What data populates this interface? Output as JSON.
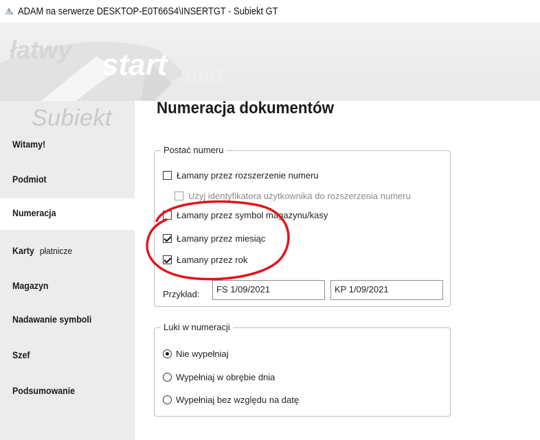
{
  "window": {
    "title": "ADAM na serwerze DESKTOP-E0T66S4\\INSERTGT - Subiekt GT",
    "app_icon": "gt-app-icon"
  },
  "banner": {
    "words": [
      "łatwy",
      "start",
      "start"
    ]
  },
  "sidebar": {
    "logo": "Subiekt",
    "items": [
      {
        "label": "Witamy!",
        "sub": ""
      },
      {
        "label": "Podmiot",
        "sub": ""
      },
      {
        "label": "Numeracja",
        "sub": "",
        "active": true
      },
      {
        "label": "Karty",
        "sub": "płatnicze"
      },
      {
        "label": "Magazyn",
        "sub": ""
      },
      {
        "label": "Nadawanie symboli",
        "sub": ""
      },
      {
        "label": "Szef",
        "sub": ""
      },
      {
        "label": "Podsumowanie",
        "sub": ""
      }
    ]
  },
  "main": {
    "title": "Numeracja dokumentów",
    "format_group": {
      "legend": "Postać numeru",
      "options": [
        {
          "label": "Łamany przez rozszerzenie numeru",
          "checked": false,
          "enabled": true
        },
        {
          "label": "Użyj identyfikatora użytkownika do rozszerzenia numeru",
          "checked": false,
          "enabled": false
        },
        {
          "label": "Łamany przez symbol magazynu/kasy",
          "checked": false,
          "enabled": true
        },
        {
          "label": "Łamany przez miesiąc",
          "checked": true,
          "enabled": true
        },
        {
          "label": "Łamany przez rok",
          "checked": true,
          "enabled": true
        }
      ],
      "example_label": "Przykład:",
      "example_values": [
        "FS 1/09/2021",
        "KP 1/09/2021"
      ]
    },
    "gaps_group": {
      "legend": "Luki w numeracji",
      "options": [
        {
          "label": "Nie wypełniaj",
          "selected": true
        },
        {
          "label": "Wypełniaj w obrębie dnia",
          "selected": false
        },
        {
          "label": "Wypełniaj bez względu na datę",
          "selected": false
        }
      ]
    }
  },
  "annotation": {
    "color": "#e0141c"
  },
  "colors": {
    "sidebar_bg": "#ececec",
    "active_item_bg": "#ffffff",
    "group_border": "#bdbdbd",
    "annotation_red": "#e0141c"
  }
}
